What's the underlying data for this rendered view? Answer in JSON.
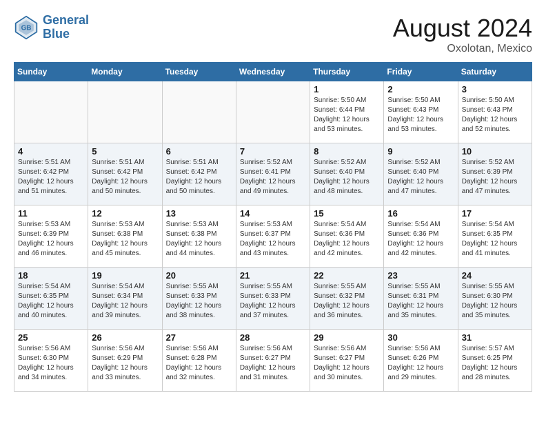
{
  "header": {
    "logo_line1": "General",
    "logo_line2": "Blue",
    "month": "August 2024",
    "location": "Oxolotan, Mexico"
  },
  "weekdays": [
    "Sunday",
    "Monday",
    "Tuesday",
    "Wednesday",
    "Thursday",
    "Friday",
    "Saturday"
  ],
  "weeks": [
    [
      {
        "day": "",
        "info": ""
      },
      {
        "day": "",
        "info": ""
      },
      {
        "day": "",
        "info": ""
      },
      {
        "day": "",
        "info": ""
      },
      {
        "day": "1",
        "info": "Sunrise: 5:50 AM\nSunset: 6:44 PM\nDaylight: 12 hours\nand 53 minutes."
      },
      {
        "day": "2",
        "info": "Sunrise: 5:50 AM\nSunset: 6:43 PM\nDaylight: 12 hours\nand 53 minutes."
      },
      {
        "day": "3",
        "info": "Sunrise: 5:50 AM\nSunset: 6:43 PM\nDaylight: 12 hours\nand 52 minutes."
      }
    ],
    [
      {
        "day": "4",
        "info": "Sunrise: 5:51 AM\nSunset: 6:42 PM\nDaylight: 12 hours\nand 51 minutes."
      },
      {
        "day": "5",
        "info": "Sunrise: 5:51 AM\nSunset: 6:42 PM\nDaylight: 12 hours\nand 50 minutes."
      },
      {
        "day": "6",
        "info": "Sunrise: 5:51 AM\nSunset: 6:42 PM\nDaylight: 12 hours\nand 50 minutes."
      },
      {
        "day": "7",
        "info": "Sunrise: 5:52 AM\nSunset: 6:41 PM\nDaylight: 12 hours\nand 49 minutes."
      },
      {
        "day": "8",
        "info": "Sunrise: 5:52 AM\nSunset: 6:40 PM\nDaylight: 12 hours\nand 48 minutes."
      },
      {
        "day": "9",
        "info": "Sunrise: 5:52 AM\nSunset: 6:40 PM\nDaylight: 12 hours\nand 47 minutes."
      },
      {
        "day": "10",
        "info": "Sunrise: 5:52 AM\nSunset: 6:39 PM\nDaylight: 12 hours\nand 47 minutes."
      }
    ],
    [
      {
        "day": "11",
        "info": "Sunrise: 5:53 AM\nSunset: 6:39 PM\nDaylight: 12 hours\nand 46 minutes."
      },
      {
        "day": "12",
        "info": "Sunrise: 5:53 AM\nSunset: 6:38 PM\nDaylight: 12 hours\nand 45 minutes."
      },
      {
        "day": "13",
        "info": "Sunrise: 5:53 AM\nSunset: 6:38 PM\nDaylight: 12 hours\nand 44 minutes."
      },
      {
        "day": "14",
        "info": "Sunrise: 5:53 AM\nSunset: 6:37 PM\nDaylight: 12 hours\nand 43 minutes."
      },
      {
        "day": "15",
        "info": "Sunrise: 5:54 AM\nSunset: 6:36 PM\nDaylight: 12 hours\nand 42 minutes."
      },
      {
        "day": "16",
        "info": "Sunrise: 5:54 AM\nSunset: 6:36 PM\nDaylight: 12 hours\nand 42 minutes."
      },
      {
        "day": "17",
        "info": "Sunrise: 5:54 AM\nSunset: 6:35 PM\nDaylight: 12 hours\nand 41 minutes."
      }
    ],
    [
      {
        "day": "18",
        "info": "Sunrise: 5:54 AM\nSunset: 6:35 PM\nDaylight: 12 hours\nand 40 minutes."
      },
      {
        "day": "19",
        "info": "Sunrise: 5:54 AM\nSunset: 6:34 PM\nDaylight: 12 hours\nand 39 minutes."
      },
      {
        "day": "20",
        "info": "Sunrise: 5:55 AM\nSunset: 6:33 PM\nDaylight: 12 hours\nand 38 minutes."
      },
      {
        "day": "21",
        "info": "Sunrise: 5:55 AM\nSunset: 6:33 PM\nDaylight: 12 hours\nand 37 minutes."
      },
      {
        "day": "22",
        "info": "Sunrise: 5:55 AM\nSunset: 6:32 PM\nDaylight: 12 hours\nand 36 minutes."
      },
      {
        "day": "23",
        "info": "Sunrise: 5:55 AM\nSunset: 6:31 PM\nDaylight: 12 hours\nand 35 minutes."
      },
      {
        "day": "24",
        "info": "Sunrise: 5:55 AM\nSunset: 6:30 PM\nDaylight: 12 hours\nand 35 minutes."
      }
    ],
    [
      {
        "day": "25",
        "info": "Sunrise: 5:56 AM\nSunset: 6:30 PM\nDaylight: 12 hours\nand 34 minutes."
      },
      {
        "day": "26",
        "info": "Sunrise: 5:56 AM\nSunset: 6:29 PM\nDaylight: 12 hours\nand 33 minutes."
      },
      {
        "day": "27",
        "info": "Sunrise: 5:56 AM\nSunset: 6:28 PM\nDaylight: 12 hours\nand 32 minutes."
      },
      {
        "day": "28",
        "info": "Sunrise: 5:56 AM\nSunset: 6:27 PM\nDaylight: 12 hours\nand 31 minutes."
      },
      {
        "day": "29",
        "info": "Sunrise: 5:56 AM\nSunset: 6:27 PM\nDaylight: 12 hours\nand 30 minutes."
      },
      {
        "day": "30",
        "info": "Sunrise: 5:56 AM\nSunset: 6:26 PM\nDaylight: 12 hours\nand 29 minutes."
      },
      {
        "day": "31",
        "info": "Sunrise: 5:57 AM\nSunset: 6:25 PM\nDaylight: 12 hours\nand 28 minutes."
      }
    ]
  ]
}
